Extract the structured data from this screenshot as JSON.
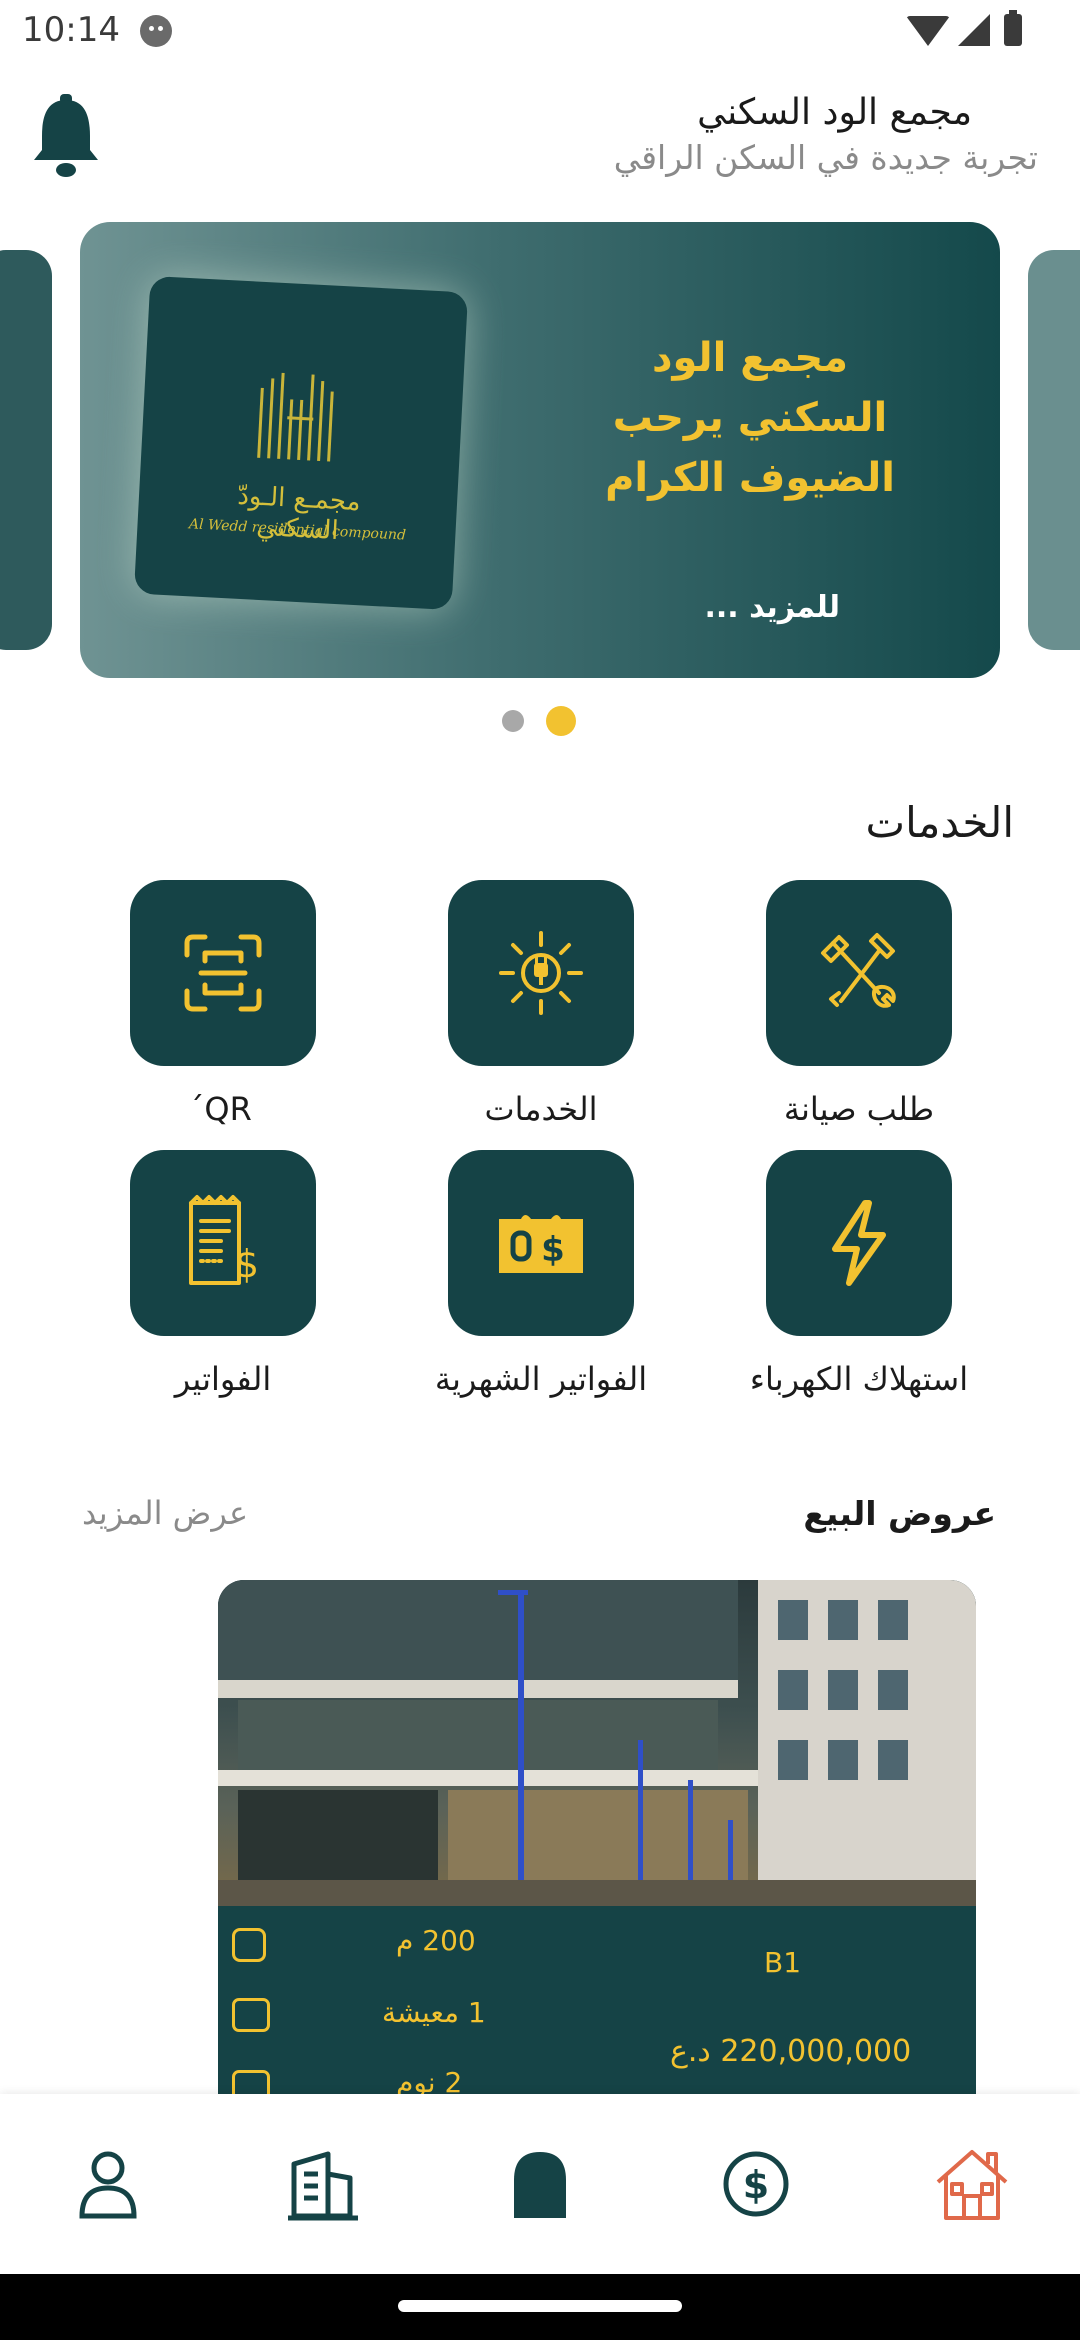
{
  "status_bar": {
    "time": "10:14"
  },
  "header": {
    "title": "مجمع الود السكني",
    "subtitle": "تجربة جديدة في السكن الراقي"
  },
  "banner": {
    "headline": "مجمع الود السكني يرحب الضيوف الكرام",
    "more_label": "للمزيد ...",
    "logo_ar": "مجمـع الـودّ السكني",
    "logo_en": "Al Wedd residential compound",
    "page_count": 2,
    "active_page": 2
  },
  "services": {
    "title": "الخدمات",
    "items": [
      {
        "label": "طلب صيانة",
        "icon": "wrench-hammer-icon"
      },
      {
        "label": "الخدمات",
        "icon": "sun-plug-icon"
      },
      {
        "label": "QR ́",
        "icon": "qr-scan-icon"
      },
      {
        "label": "استهلاك الكهرباء",
        "icon": "lightning-icon"
      },
      {
        "label": "الفواتير الشهرية",
        "icon": "monthly-bill-icon"
      },
      {
        "label": "الفواتير",
        "icon": "receipt-icon"
      }
    ]
  },
  "sales": {
    "title": "عروض البيع",
    "more_label": "عرض المزيد",
    "listing": {
      "code": "B1",
      "area": "200 م",
      "living": "1 معيشة",
      "bedrooms": "2 نوم",
      "price": "220,000,000 د.ع"
    }
  },
  "bottom_nav": [
    {
      "name": "profile",
      "icon": "person-icon"
    },
    {
      "name": "buildings",
      "icon": "building-icon"
    },
    {
      "name": "home-arch",
      "icon": "arch-icon"
    },
    {
      "name": "payments",
      "icon": "dollar-circle-icon"
    },
    {
      "name": "home",
      "icon": "house-icon",
      "active": true
    }
  ],
  "colors": {
    "primary": "#154346",
    "accent": "#f2c230",
    "nav_active": "#e0694a"
  }
}
